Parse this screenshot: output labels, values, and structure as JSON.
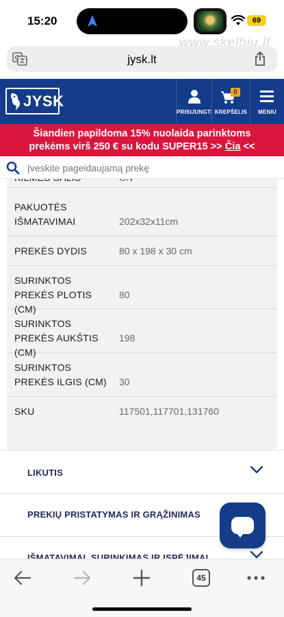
{
  "status": {
    "time": "15:20",
    "battery": "69"
  },
  "browser": {
    "url": "jysk.lt",
    "watermark": "www.skelbiu.lt",
    "tabs_count": "45"
  },
  "header": {
    "logo_text": "JYSK",
    "login_label": "PRISIJUNGTI",
    "cart_label": "KREPŠELIS",
    "cart_count": "0",
    "menu_label": "MENIU"
  },
  "promo": {
    "line1": "Šiandien papildoma 15% nuolaida parinktoms",
    "line2_prefix": "prekėms virš 250 € su kodu SUPER15 >> ",
    "line2_link": "Čia",
    "line2_suffix": " <<"
  },
  "search": {
    "placeholder": "Įveskite pageidaujamą prekę"
  },
  "specs": {
    "partial_label": "KILMĖS ŠALIS",
    "partial_value": "CN",
    "rows": [
      {
        "label": "PAKUOTĖS IŠMATAVIMAI",
        "value": "202x32x11cm"
      },
      {
        "label": "PREKĖS DYDIS",
        "value": "80 x 198 x 30 cm"
      },
      {
        "label": "SURINKTOS PREKĖS PLOTIS (CM)",
        "value": "80"
      },
      {
        "label": "SURINKTOS PREKĖS AUKŠTIS (CM)",
        "value": "198"
      },
      {
        "label": "SURINKTOS PREKĖS ILGIS (CM)",
        "value": "30"
      },
      {
        "label": "SKU",
        "value": "117501,117701,131760"
      }
    ]
  },
  "accordion": [
    {
      "label": "LIKUTIS"
    },
    {
      "label": "PREKIŲ PRISTATYMAS IR GRĄŽINIMAS"
    },
    {
      "label": "IŠMATAVIMAI, SURINKIMAS IR ĮSPĖJIMAI"
    }
  ],
  "colors": {
    "brand_blue": "#143c8a",
    "promo_red": "#d9173d",
    "badge_orange": "#f2a51a"
  }
}
